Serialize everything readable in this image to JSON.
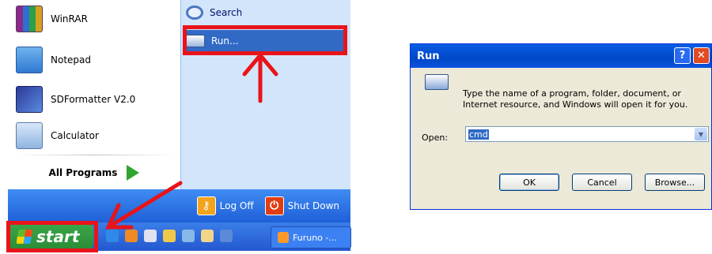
{
  "start_menu": {
    "programs": [
      {
        "label": "WinRAR",
        "icon": "winrar-icon"
      },
      {
        "label": "Notepad",
        "icon": "notepad-icon"
      },
      {
        "label": "SDFormatter V2.0",
        "icon": "sdformatter-icon"
      },
      {
        "label": "Calculator",
        "icon": "calculator-icon"
      }
    ],
    "all_programs_label": "All Programs",
    "right_items": [
      {
        "label": "Search",
        "icon": "search-icon"
      },
      {
        "label": "Run...",
        "icon": "run-icon"
      }
    ],
    "log_off_label": "Log Off",
    "shut_down_label": "Shut Down"
  },
  "taskbar": {
    "start_label": "start",
    "task_button_label": "Furuno -..."
  },
  "run_dialog": {
    "title": "Run",
    "description": "Type the name of a program, folder, document, or Internet resource, and Windows will open it for you.",
    "open_label": "Open:",
    "open_value": "cmd",
    "ok_label": "OK",
    "cancel_label": "Cancel",
    "browse_label": "Browse..."
  },
  "colors": {
    "annotation_red": "#e8141a",
    "xp_blue": "#0a5ee6",
    "start_green": "#2b8a35"
  }
}
